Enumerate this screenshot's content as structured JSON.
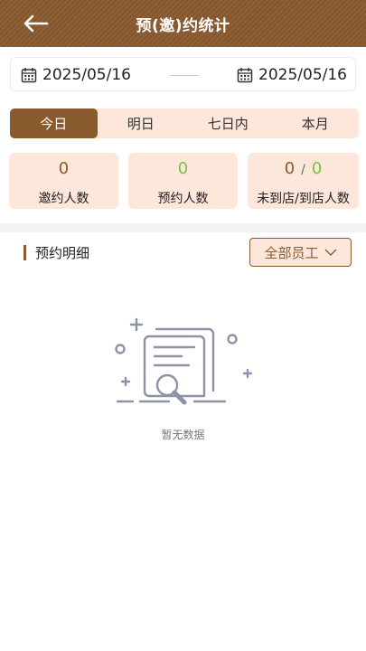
{
  "header": {
    "title": "预(邀)约统计",
    "back_icon": "arrow-left-icon"
  },
  "date_range": {
    "start": "2025/05/16",
    "end": "2025/05/16",
    "icon": "calendar-icon"
  },
  "tabs": [
    {
      "label": "今日",
      "active": true
    },
    {
      "label": "明日",
      "active": false
    },
    {
      "label": "七日内",
      "active": false
    },
    {
      "label": "本月",
      "active": false
    }
  ],
  "stats": {
    "invited": {
      "value": "0",
      "label": "邀约人数"
    },
    "reserved": {
      "value": "0",
      "label": "预约人数"
    },
    "arrival": {
      "not_arrived": "0",
      "separator": "/",
      "arrived": "0",
      "label": "未到店/到店人数"
    }
  },
  "section": {
    "title": "预约明细",
    "filter_label": "全部员工",
    "filter_icon": "chevron-down-icon"
  },
  "empty_state": {
    "text": "暂无数据",
    "icon": "empty-document-search-icon"
  },
  "colors": {
    "primary": "#8a5a2f",
    "accent_bg": "#fde6da",
    "green": "#7bc142"
  }
}
